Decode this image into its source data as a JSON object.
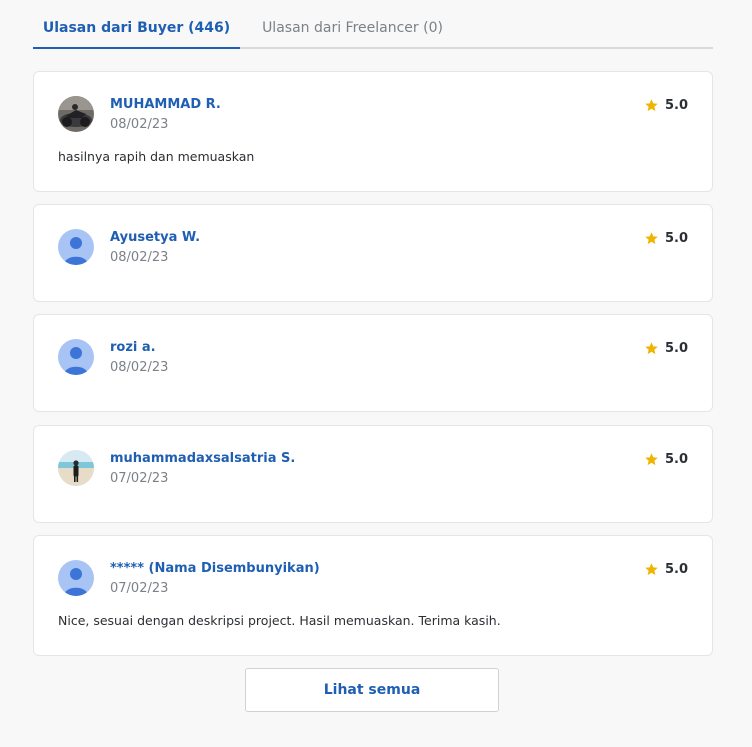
{
  "tabs": [
    {
      "label": "Ulasan dari Buyer (446)",
      "active": true
    },
    {
      "label": "Ulasan dari Freelancer (0)",
      "active": false
    }
  ],
  "reviews": [
    {
      "name": "MUHAMMAD R.",
      "date": "08/02/23",
      "rating": "5.0",
      "comment": "hasilnya rapih dan memuaskan",
      "avatar": "photo-motorcycle"
    },
    {
      "name": "Ayusetya W.",
      "date": "08/02/23",
      "rating": "5.0",
      "comment": "",
      "avatar": "default-user"
    },
    {
      "name": "rozi a.",
      "date": "08/02/23",
      "rating": "5.0",
      "comment": "",
      "avatar": "default-user"
    },
    {
      "name": "muhammadaxsalsatria S.",
      "date": "07/02/23",
      "rating": "5.0",
      "comment": "",
      "avatar": "photo-beach"
    },
    {
      "name": "***** (Nama Disembunyikan)",
      "date": "07/02/23",
      "rating": "5.0",
      "comment": "Nice, sesuai dengan deskripsi project. Hasil memuaskan. Terima kasih.",
      "avatar": "default-user"
    }
  ],
  "see_all_label": "Lihat semua",
  "colors": {
    "accent": "#1f5fb3",
    "star": "#f0b400",
    "default_avatar_bg": "#a8c4f5",
    "default_avatar_fg": "#3d74d8"
  }
}
